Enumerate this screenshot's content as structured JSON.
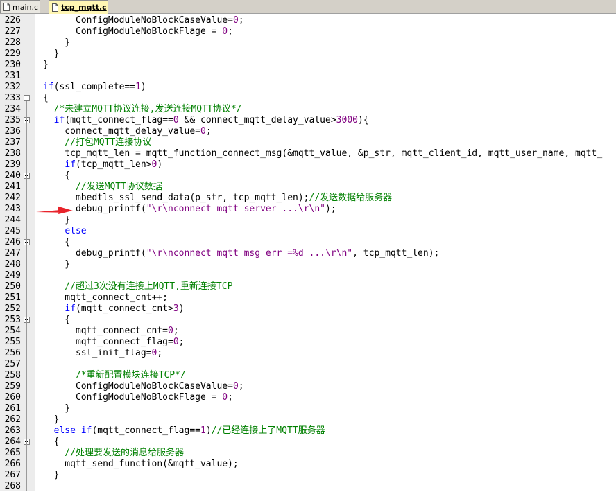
{
  "tabs": [
    {
      "label": "main.c",
      "active": false,
      "icon": "c-file-icon"
    },
    {
      "label": "tcp_mqtt.c",
      "active": true,
      "icon": "c-file-icon"
    }
  ],
  "colors": {
    "keyword": "#0000ff",
    "number": "#800080",
    "string": "#800080",
    "comment": "#008000",
    "arrow": "#e8232b"
  },
  "lines": [
    {
      "n": "226",
      "fold": false,
      "parts": [
        [
          "",
          "      ConfigModuleNoBlockCaseValue="
        ],
        [
          "num",
          "0"
        ],
        [
          "",
          ";"
        ]
      ]
    },
    {
      "n": "227",
      "fold": false,
      "parts": [
        [
          "",
          "      ConfigModuleNoBlockFlage = "
        ],
        [
          "num",
          "0"
        ],
        [
          "",
          ";"
        ]
      ]
    },
    {
      "n": "228",
      "fold": false,
      "parts": [
        [
          "",
          "    }"
        ]
      ]
    },
    {
      "n": "229",
      "fold": false,
      "parts": [
        [
          "",
          "  }"
        ]
      ]
    },
    {
      "n": "230",
      "fold": false,
      "parts": [
        [
          "",
          "}"
        ]
      ]
    },
    {
      "n": "231",
      "fold": false,
      "parts": []
    },
    {
      "n": "232",
      "fold": false,
      "parts": [
        [
          "kw",
          "if"
        ],
        [
          "",
          "(ssl_complete=="
        ],
        [
          "num",
          "1"
        ],
        [
          "",
          ")"
        ]
      ]
    },
    {
      "n": "233",
      "fold": true,
      "parts": [
        [
          "",
          "{"
        ]
      ]
    },
    {
      "n": "234",
      "fold": false,
      "parts": [
        [
          "cm",
          "  /*未建立MQTT协议连接,发送连接MQTT协议*/"
        ]
      ]
    },
    {
      "n": "235",
      "fold": true,
      "parts": [
        [
          "",
          "  "
        ],
        [
          "kw",
          "if"
        ],
        [
          "",
          "(mqtt_connect_flag=="
        ],
        [
          "num",
          "0"
        ],
        [
          "",
          " && connect_mqtt_delay_value>"
        ],
        [
          "num",
          "3000"
        ],
        [
          "",
          "){"
        ]
      ]
    },
    {
      "n": "236",
      "fold": false,
      "parts": [
        [
          "",
          "    connect_mqtt_delay_value="
        ],
        [
          "num",
          "0"
        ],
        [
          "",
          ";"
        ]
      ]
    },
    {
      "n": "237",
      "fold": false,
      "parts": [
        [
          "cm",
          "    //打包MQTT连接协议"
        ]
      ]
    },
    {
      "n": "238",
      "fold": false,
      "parts": [
        [
          "",
          "    tcp_mqtt_len = mqtt_function_connect_msg(&mqtt_value, &p_str, mqtt_client_id, mqtt_user_name, mqtt_"
        ]
      ]
    },
    {
      "n": "239",
      "fold": false,
      "parts": [
        [
          "",
          "    "
        ],
        [
          "kw",
          "if"
        ],
        [
          "",
          "(tcp_mqtt_len>"
        ],
        [
          "num",
          "0"
        ],
        [
          "",
          ")"
        ]
      ]
    },
    {
      "n": "240",
      "fold": true,
      "parts": [
        [
          "",
          "    {"
        ]
      ]
    },
    {
      "n": "241",
      "fold": false,
      "parts": [
        [
          "cm",
          "      //发送MQTT协议数据"
        ]
      ]
    },
    {
      "n": "242",
      "fold": false,
      "parts": [
        [
          "",
          "      mbedtls_ssl_send_data(p_str, tcp_mqtt_len);"
        ],
        [
          "cm",
          "//发送数据给服务器"
        ]
      ]
    },
    {
      "n": "243",
      "fold": false,
      "parts": [
        [
          "",
          "      debug_printf("
        ],
        [
          "str",
          "\"\\r\\nconnect mqtt server ...\\r\\n\""
        ],
        [
          "",
          ");"
        ]
      ]
    },
    {
      "n": "244",
      "fold": false,
      "parts": [
        [
          "",
          "    }"
        ]
      ]
    },
    {
      "n": "245",
      "fold": false,
      "parts": [
        [
          "",
          "    "
        ],
        [
          "kw",
          "else"
        ]
      ]
    },
    {
      "n": "246",
      "fold": true,
      "parts": [
        [
          "",
          "    {"
        ]
      ]
    },
    {
      "n": "247",
      "fold": false,
      "parts": [
        [
          "",
          "      debug_printf("
        ],
        [
          "str",
          "\"\\r\\nconnect mqtt msg err =%d ...\\r\\n\""
        ],
        [
          "",
          ", tcp_mqtt_len);"
        ]
      ]
    },
    {
      "n": "248",
      "fold": false,
      "parts": [
        [
          "",
          "    }"
        ]
      ]
    },
    {
      "n": "249",
      "fold": false,
      "parts": []
    },
    {
      "n": "250",
      "fold": false,
      "parts": [
        [
          "cm",
          "    //超过3次没有连接上MQTT,重新连接TCP"
        ]
      ]
    },
    {
      "n": "251",
      "fold": false,
      "parts": [
        [
          "",
          "    mqtt_connect_cnt++;"
        ]
      ]
    },
    {
      "n": "252",
      "fold": false,
      "parts": [
        [
          "",
          "    "
        ],
        [
          "kw",
          "if"
        ],
        [
          "",
          "(mqtt_connect_cnt>"
        ],
        [
          "num",
          "3"
        ],
        [
          "",
          ")"
        ]
      ]
    },
    {
      "n": "253",
      "fold": true,
      "parts": [
        [
          "",
          "    {"
        ]
      ]
    },
    {
      "n": "254",
      "fold": false,
      "parts": [
        [
          "",
          "      mqtt_connect_cnt="
        ],
        [
          "num",
          "0"
        ],
        [
          "",
          ";"
        ]
      ]
    },
    {
      "n": "255",
      "fold": false,
      "parts": [
        [
          "",
          "      mqtt_connect_flag="
        ],
        [
          "num",
          "0"
        ],
        [
          "",
          ";"
        ]
      ]
    },
    {
      "n": "256",
      "fold": false,
      "parts": [
        [
          "",
          "      ssl_init_flag="
        ],
        [
          "num",
          "0"
        ],
        [
          "",
          ";"
        ]
      ]
    },
    {
      "n": "257",
      "fold": false,
      "parts": []
    },
    {
      "n": "258",
      "fold": false,
      "parts": [
        [
          "cm",
          "      /*重新配置模块连接TCP*/"
        ]
      ]
    },
    {
      "n": "259",
      "fold": false,
      "parts": [
        [
          "",
          "      ConfigModuleNoBlockCaseValue="
        ],
        [
          "num",
          "0"
        ],
        [
          "",
          ";"
        ]
      ]
    },
    {
      "n": "260",
      "fold": false,
      "parts": [
        [
          "",
          "      ConfigModuleNoBlockFlage = "
        ],
        [
          "num",
          "0"
        ],
        [
          "",
          ";"
        ]
      ]
    },
    {
      "n": "261",
      "fold": false,
      "parts": [
        [
          "",
          "    }"
        ]
      ]
    },
    {
      "n": "262",
      "fold": false,
      "parts": [
        [
          "",
          "  }"
        ]
      ]
    },
    {
      "n": "263",
      "fold": false,
      "parts": [
        [
          "",
          "  "
        ],
        [
          "kw",
          "else if"
        ],
        [
          "",
          "(mqtt_connect_flag=="
        ],
        [
          "num",
          "1"
        ],
        [
          "",
          ")"
        ],
        [
          "cm",
          "//已经连接上了MQTT服务器"
        ]
      ]
    },
    {
      "n": "264",
      "fold": true,
      "parts": [
        [
          "",
          "  {"
        ]
      ]
    },
    {
      "n": "265",
      "fold": false,
      "parts": [
        [
          "cm",
          "    //处理要发送的消息给服务器"
        ]
      ]
    },
    {
      "n": "266",
      "fold": false,
      "parts": [
        [
          "",
          "    mqtt_send_function(&mqtt_value);"
        ]
      ]
    },
    {
      "n": "267",
      "fold": false,
      "parts": [
        [
          "",
          "  }"
        ]
      ]
    },
    {
      "n": "268",
      "fold": false,
      "parts": []
    }
  ]
}
